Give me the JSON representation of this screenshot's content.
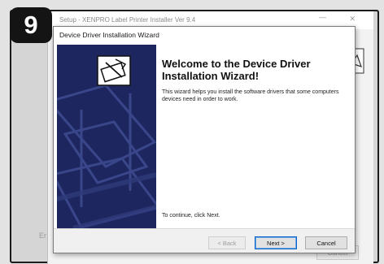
{
  "step": {
    "number": "9"
  },
  "background_window": {
    "title": "Setup - XENPRO Label Printer Installer Ver 9.4",
    "left_fragment": "Er",
    "cancel_label": "Cancel"
  },
  "wizard": {
    "title": "Device Driver Installation Wizard",
    "heading": "Welcome to the Device Driver Installation Wizard!",
    "description": "This wizard helps you install the software drivers that some computers devices need in order to work.",
    "continue_text": "To continue, click Next.",
    "buttons": {
      "back": "< Back",
      "next": "Next >",
      "cancel": "Cancel"
    },
    "sidebar_icon": "driver-install-icon"
  },
  "colors": {
    "sidebar": "#1e2660",
    "badge": "#141414",
    "default_button_border": "#0a64c8"
  }
}
